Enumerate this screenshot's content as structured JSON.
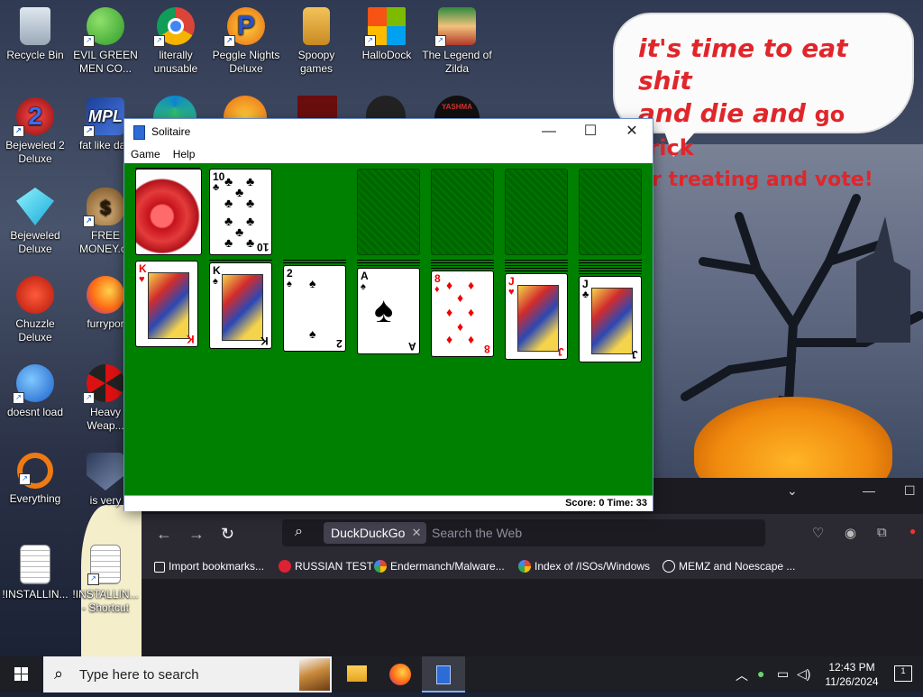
{
  "desktop": {
    "icons": [
      {
        "label": "Recycle Bin"
      },
      {
        "label": "EVIL GREEN MEN CO..."
      },
      {
        "label": "literally unusable"
      },
      {
        "label": "Peggle Nights Deluxe"
      },
      {
        "label": "Spoopy games"
      },
      {
        "label": "HalloDock"
      },
      {
        "label": "The Legend of Zilda"
      },
      {
        "label": "Bejeweled 2 Deluxe"
      },
      {
        "label": "fat like darl"
      },
      {
        "label": "Bejeweled Deluxe"
      },
      {
        "label": "FREE MONEY.cc"
      },
      {
        "label": "Chuzzle Deluxe"
      },
      {
        "label": "furrypor"
      },
      {
        "label": "doesnt load"
      },
      {
        "label": "Heavy Weap..."
      },
      {
        "label": "Everything"
      },
      {
        "label": "is very"
      },
      {
        "label": "!INSTALLIN..."
      },
      {
        "label": "!INSTALLIN... - Shortcut"
      }
    ],
    "speech_bubble": {
      "line1": "it's time to eat shit",
      "line2a": "and die and",
      "line2b": "go trick",
      "line3": "or treating and vote!"
    },
    "partial_icon_label": "YASHMA"
  },
  "solitaire": {
    "title": "Solitaire",
    "menu": [
      "Game",
      "Help"
    ],
    "window_buttons": {
      "minimize": "—",
      "maximize": "☐",
      "close": "✕"
    },
    "stock_top": {
      "rank": "10",
      "suit": "♣"
    },
    "tableau": [
      {
        "rank": "K",
        "suit": "♥",
        "color": "red"
      },
      {
        "rank": "K",
        "suit": "♠",
        "color": "black"
      },
      {
        "rank": "2",
        "suit": "♠",
        "color": "black"
      },
      {
        "rank": "A",
        "suit": "♠",
        "color": "black"
      },
      {
        "rank": "8",
        "suit": "♦",
        "color": "red"
      },
      {
        "rank": "J",
        "suit": "♥",
        "color": "red"
      },
      {
        "rank": "J",
        "suit": "♣",
        "color": "black"
      }
    ],
    "status": "Score: 0 Time: 33"
  },
  "browser": {
    "search_engine_chip": "DuckDuckGo",
    "search_placeholder": "Search the Web",
    "bookmarks": [
      {
        "label": "Import bookmarks..."
      },
      {
        "label": "RUSSIAN TEST"
      },
      {
        "label": "Endermanch/Malware..."
      },
      {
        "label": "Index of /ISOs/Windows"
      },
      {
        "label": "MEMZ and Noescape ..."
      }
    ]
  },
  "taskbar": {
    "search_placeholder": "Type here to search",
    "time": "12:43 PM",
    "date": "11/26/2024",
    "notification_count": "1"
  },
  "colors": {
    "felt": "#008000",
    "taskbar": "#1d1f25",
    "browser_bg": "#2b2a33",
    "speech_text": "#e0262b"
  }
}
